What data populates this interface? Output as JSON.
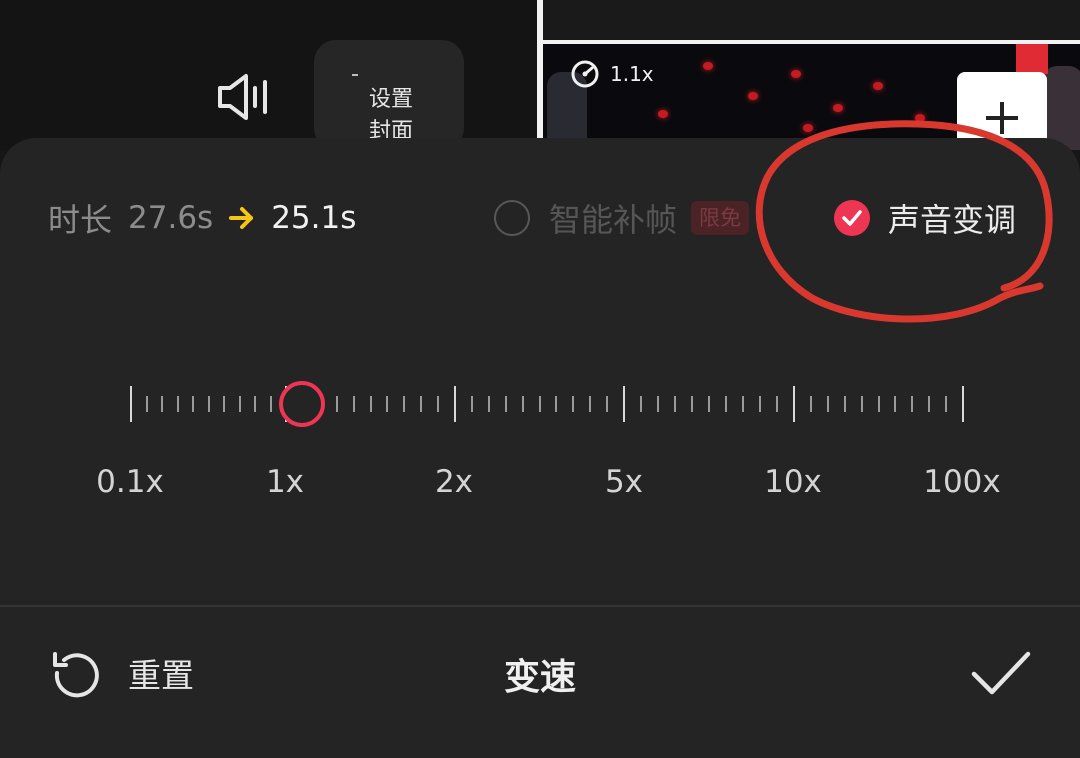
{
  "background": {
    "cover_button_label": "设置\n封面",
    "clip_speed": "1.1x",
    "icons": {
      "volume": "speaker-icon",
      "speed": "speed-gauge-icon",
      "add": "plus-icon"
    }
  },
  "sheet": {
    "title": "变速",
    "duration": {
      "label": "时长",
      "original": "27.6s",
      "new": "25.1s"
    },
    "smart_frame": {
      "label": "智能补帧",
      "badge": "限免",
      "checked": false
    },
    "pitch_change": {
      "label": "声音变调",
      "checked": true
    },
    "speed_scale": {
      "labels": [
        "0.1x",
        "1x",
        "2x",
        "5x",
        "10x",
        "100x"
      ],
      "current_value": "1.1x"
    },
    "reset_label": "重置",
    "confirm_icon": "checkmark-icon",
    "reset_icon": "reset-icon"
  },
  "colors": {
    "accent": "#ee3553",
    "arrow": "#f5c518",
    "annotation": "#d9382e",
    "sheet_bg": "#242424"
  }
}
